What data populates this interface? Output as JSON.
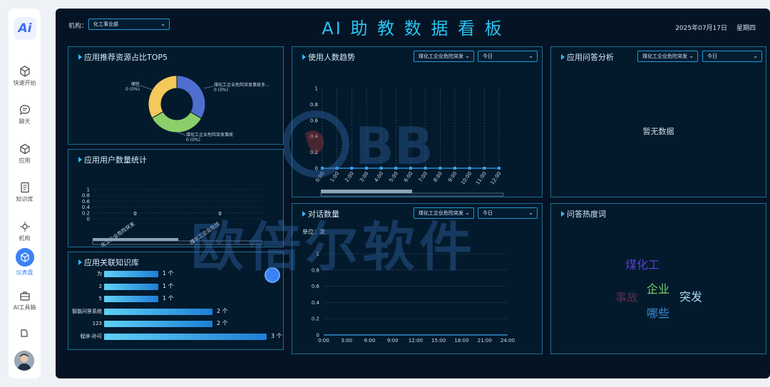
{
  "sidebar": {
    "logo": "Ai",
    "items": [
      {
        "label": "快速开始",
        "icon": "cube-icon"
      },
      {
        "label": "聊天",
        "icon": "chat-icon"
      },
      {
        "label": "应用",
        "icon": "app-icon"
      },
      {
        "label": "知识库",
        "icon": "book-icon"
      },
      {
        "label": "机构",
        "icon": "org-icon"
      },
      {
        "label": "仪表盘",
        "icon": "dashboard-icon"
      },
      {
        "label": "AI工具箱",
        "icon": "toolbox-icon"
      }
    ]
  },
  "header": {
    "org_label": "机构：",
    "org_select": "化工事业部",
    "title": "AI 助 教 数 据 看 板",
    "date": "2025年07月17日",
    "weekday": "星期四"
  },
  "panels": {
    "top5": {
      "title": "应用推荐资源占比TOP5"
    },
    "users": {
      "title": "应用用户数量统计"
    },
    "kb": {
      "title": "应用关联知识库"
    },
    "usage": {
      "title": "使用人数趋势",
      "select_app": "煤化工企业危险突发",
      "select_day": "今日"
    },
    "qa": {
      "title": "应用问答分析",
      "select_app": "煤化工企业危险突发",
      "select_day": "今日",
      "empty": "暂无数据"
    },
    "dialog": {
      "title": "对话数量",
      "select_app": "煤化工企业危险突发",
      "select_day": "今日",
      "unit": "单位：次"
    },
    "hotwords": {
      "title": "问答热度词"
    }
  },
  "chart_data": [
    {
      "type": "pie",
      "title": "应用推荐资源占比TOP5",
      "slices": [
        {
          "name": "煤化工企业危险突发事故多…",
          "value": 0,
          "label": "0 (0%)",
          "color": "#4f6fd0"
        },
        {
          "name": "煤化工企业危险突发事故",
          "value": 0,
          "label": "0 (0%)",
          "color": "#8ccf6a"
        },
        {
          "name": "哪些",
          "value": 0,
          "label": "0 (0%)",
          "color": "#f4c85a"
        }
      ]
    },
    {
      "type": "bar",
      "title": "应用用户数量统计",
      "categories": [
        "化工企业危险突发",
        "煤化工企业危险"
      ],
      "values": [
        0,
        0
      ],
      "yticks": [
        0,
        0.2,
        0.4,
        0.6,
        0.8,
        1
      ],
      "ylim": [
        0,
        1
      ]
    },
    {
      "type": "bar",
      "orientation": "horizontal",
      "title": "应用关联知识库",
      "categories": [
        "为",
        "2",
        "5",
        "智能问答系统",
        "123",
        "程序-孙可"
      ],
      "values": [
        1,
        1,
        1,
        2,
        2,
        3
      ],
      "value_labels": [
        "1 个",
        "1 个",
        "1 个",
        "2 个",
        "2 个",
        "3 个"
      ]
    },
    {
      "type": "line",
      "title": "使用人数趋势",
      "x": [
        "0:00",
        "1:00",
        "2:00",
        "3:00",
        "4:00",
        "5:00",
        "6:00",
        "7:00",
        "8:00",
        "9:00",
        "10:00",
        "11:00",
        "12:00"
      ],
      "y": [
        0,
        0,
        0,
        0,
        0,
        0,
        0,
        0,
        0,
        0,
        0,
        0,
        0
      ],
      "yticks": [
        0,
        0.2,
        0.4,
        0.6,
        0.8,
        1
      ],
      "ylim": [
        0,
        1
      ]
    },
    {
      "type": "line",
      "title": "对话数量",
      "x": [
        "0:00",
        "3:00",
        "6:00",
        "9:00",
        "12:00",
        "15:00",
        "18:00",
        "21:00",
        "24:00"
      ],
      "y": [
        0,
        0,
        0,
        0,
        0,
        0,
        0,
        0,
        0
      ],
      "yticks": [
        0,
        0.2,
        0.4,
        0.6,
        0.8,
        1
      ],
      "ylim": [
        0,
        1
      ]
    }
  ],
  "hotwords": [
    {
      "text": "煤化工",
      "color": "#5a3fd6"
    },
    {
      "text": "企业",
      "color": "#7bd06a"
    },
    {
      "text": "事故",
      "color": "#5a2a4a"
    },
    {
      "text": "突发",
      "color": "#a8d8f0"
    },
    {
      "text": "哪些",
      "color": "#3a8fd8"
    }
  ],
  "watermark": "欧倍尔软件"
}
